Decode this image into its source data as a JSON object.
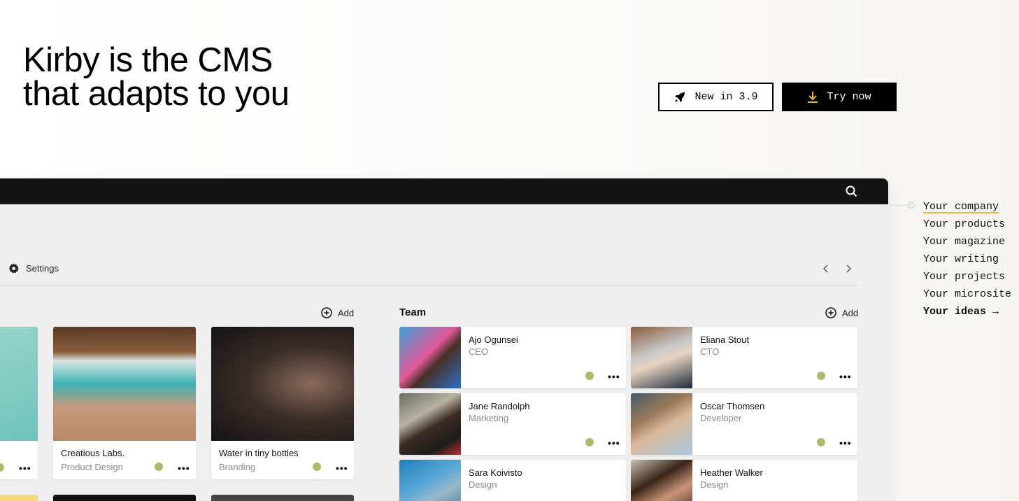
{
  "hero": {
    "line1": "Kirby is the CMS",
    "line2": "that adapts to you"
  },
  "buttons": {
    "new_label": "New in 3.9",
    "try_label": "Try now"
  },
  "panel": {
    "settings_label": "Settings",
    "add_label": "Add",
    "team_title": "Team"
  },
  "projects": [
    {
      "title": "Creatious Labs.",
      "subtitle": "Product Design"
    },
    {
      "title": "Water in tiny bottles",
      "subtitle": "Branding"
    }
  ],
  "team": [
    {
      "name": "Ajo Ogunsei",
      "role": "CEO"
    },
    {
      "name": "Eliana Stout",
      "role": "CTO"
    },
    {
      "name": "Jane Randolph",
      "role": "Marketing"
    },
    {
      "name": "Oscar Thomsen",
      "role": "Developer"
    },
    {
      "name": "Sara Koivisto",
      "role": "Design"
    },
    {
      "name": "Heather Walker",
      "role": "Design"
    }
  ],
  "more_glyph": "•••",
  "side_list": [
    "Your company",
    "Your products",
    "Your magazine",
    "Your writing",
    "Your projects",
    "Your microsite",
    "Your ideas →"
  ],
  "colors": {
    "status_dot": "#a7bd6c",
    "accent_underline": "#f0b52c",
    "topbar": "#141414"
  }
}
